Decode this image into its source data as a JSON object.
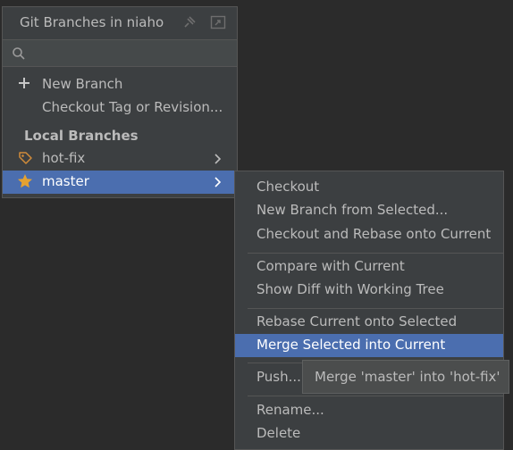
{
  "popup": {
    "title": "Git Branches in niaho",
    "search_placeholder": "",
    "actions": [
      {
        "label": "New Branch",
        "icon": "plus-icon"
      },
      {
        "label": "Checkout Tag or Revision..."
      }
    ],
    "section_label": "Local Branches",
    "branches": [
      {
        "label": "hot-fix",
        "icon": "tag-icon"
      },
      {
        "label": "master",
        "icon": "star-icon",
        "selected": true
      }
    ]
  },
  "submenu": {
    "items": [
      "Checkout",
      "New Branch from Selected...",
      "Checkout and Rebase onto Current",
      "Compare with Current",
      "Show Diff with Working Tree",
      "Rebase Current onto Selected",
      "Merge Selected into Current",
      "Push...",
      "Rename...",
      "Delete"
    ],
    "selected_item": "Merge Selected into Current"
  },
  "tooltip": {
    "text": "Merge 'master' into 'hot-fix'"
  },
  "colors": {
    "background": "#2b2b2b",
    "panel": "#3c3f41",
    "selection": "#4b6eaf",
    "star": "#e5a232",
    "tag": "#d08b3a"
  }
}
